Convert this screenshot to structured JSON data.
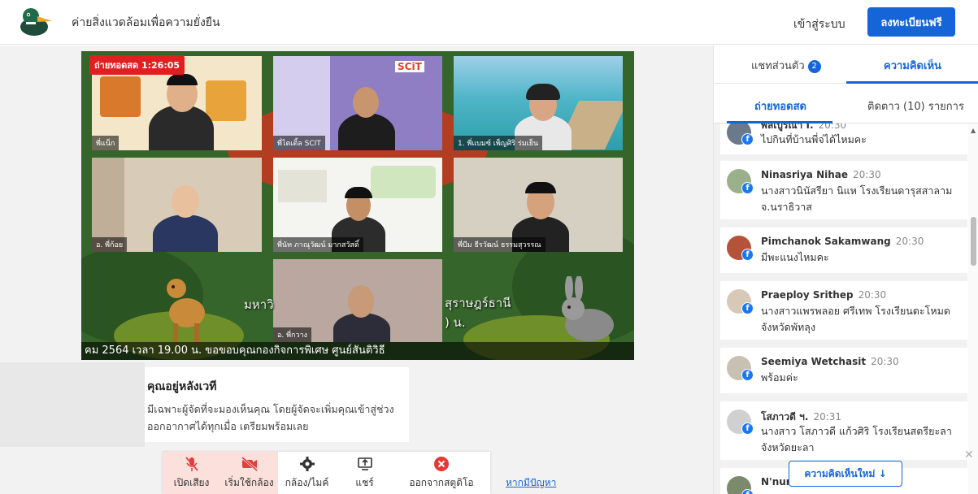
{
  "header": {
    "site_title": "ค่ายสิ่งแวดล้อมเพื่อความยั่งยืน",
    "login_label": "เข้าสู่ระบบ",
    "register_label": "ลงทะเบียนฟรี"
  },
  "stage": {
    "live_badge": "ถ่ายทอดสด 1:26:05",
    "ticker": "คม 2564 เวลา 19.00 น. ขอขอบคุณกองกิจการพิเศษ ศูนย์สันติวิธี",
    "bg_text_left": "มหาวิ",
    "bg_text_right": "สุราษฎร์ธานี",
    "bg_text_right2": ") น.",
    "tiles": [
      {
        "name": "พี่แน็ก"
      },
      {
        "name": "พี่ไตเติ้ล SCIT"
      },
      {
        "name": "1. พี่แบมซ์ เพ็ญศิริ ร่มเย็น"
      },
      {
        "name": "อ. พี่ก้อย"
      },
      {
        "name": "พี่นัท ภาณุวัฒน์ มากสวัสดิ์"
      },
      {
        "name": "พี่บีม ธีรวัฒน์ ธรรมสุวรรณ"
      },
      {
        "name": "อ. พี่กวาง"
      }
    ],
    "scit_logo": "SCiT"
  },
  "backstage": {
    "title": "คุณอยู่หลังเวที",
    "description_line1": "มีเฉพาะผู้จัดที่จะมองเห็นคุณ โดยผู้จัดจะเพิ่มคุณเข้าสู่ช่วง",
    "description_line2": "ออกอากาศได้ทุกเมื่อ เตรียมพร้อมเลย"
  },
  "controls": {
    "mic": "เปิดเสียง",
    "camera": "เริ่มใช้กล้อง",
    "settings": "กล้อง/ไมค์",
    "share": "แชร์",
    "leave": "ออกจากสตูดิโอ",
    "help": "หากมีปัญหา"
  },
  "sidebar": {
    "tab_private": "แชทส่วนตัว",
    "tab_private_count": "2",
    "tab_comments": "ความคิดเห็น",
    "subtab_live": "ถ่ายทอดสด",
    "subtab_follow": "ติดตาว (10) รายการ",
    "new_comments": "ความคิดเห็นใหม่ ↓",
    "comments": [
      {
        "name": "พลเบูรณา I.",
        "time": "20:30",
        "text": "ไปกินที่บ้านพี่จ่ได้ไหมคะ"
      },
      {
        "name": "Ninasriya Nihae",
        "time": "20:30",
        "text": "นางสาวนินัสรียา นิแห โรงเรียนดารุสสาลาม จ.นราธิวาส"
      },
      {
        "name": "Pimchanok Sakamwang",
        "time": "20:30",
        "text": "มีพะแนงไหมคะ"
      },
      {
        "name": "Praeploy Srithep",
        "time": "20:30",
        "text": "นางสาวแพรพลอย ศรีเทพ โรงเรียนตะโหมด จังหวัดพัทลุง"
      },
      {
        "name": "Seemiya Wetchasit",
        "time": "20:30",
        "text": "พร้อมค่ะ"
      },
      {
        "name": "โสภาวดี ฯ.",
        "time": "20:31",
        "text": "นางสาว โสภาวดี แก้วศิริ โรงเรียนสตรียะลา จังหวัดยะลา"
      },
      {
        "name": "N'nur",
        "time": "",
        "text": ""
      }
    ]
  },
  "colors": {
    "brand_blue": "#1565d8",
    "live_red": "#e02020",
    "facebook_blue": "#1877f2"
  }
}
